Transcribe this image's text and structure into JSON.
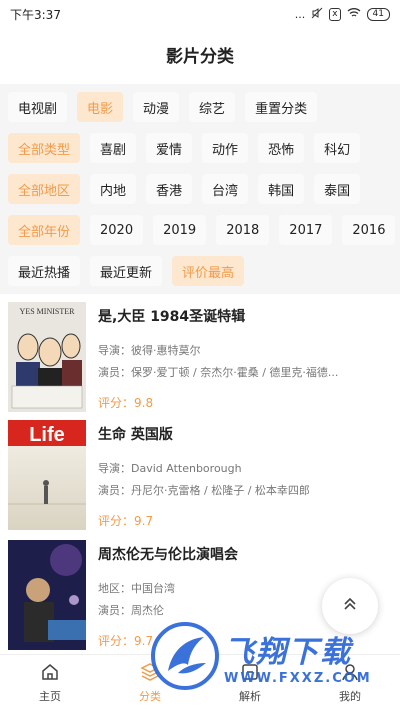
{
  "status_bar": {
    "time": "下午3:37",
    "signal": "...",
    "box_label": "x",
    "battery": "41"
  },
  "header": {
    "title": "影片分类"
  },
  "filters": {
    "row1": [
      "电视剧",
      "电影",
      "动漫",
      "综艺",
      "重置分类"
    ],
    "row1_active": 1,
    "row2": [
      "全部类型",
      "喜剧",
      "爱情",
      "动作",
      "恐怖",
      "科幻"
    ],
    "row3": [
      "全部地区",
      "内地",
      "香港",
      "台湾",
      "韩国",
      "泰国"
    ],
    "row4": [
      "全部年份",
      "2020",
      "2019",
      "2018",
      "2017",
      "2016"
    ],
    "row5": [
      "最近热播",
      "最近更新",
      "评价最高"
    ],
    "row5_active": 2
  },
  "movies": [
    {
      "title": "是,大臣 1984圣诞特辑",
      "line1": "导演：彼得·惠特莫尔",
      "line2": "演员：保罗·爱丁顿 / 奈杰尔·霍桑 / 德里克·福德...",
      "score": "评分：9.8",
      "poster_text": "YES MINISTER"
    },
    {
      "title": "生命 英国版",
      "line1": "导演：David Attenborough",
      "line2": "演员：丹尼尔·克雷格 / 松隆子 / 松本幸四郎",
      "score": "评分：9.7",
      "poster_text": "Life"
    },
    {
      "title": "周杰伦无与伦比演唱会",
      "line1": "地区：中国台湾",
      "line2": "演员：周杰伦",
      "score": "评分：9.7",
      "poster_text": ""
    }
  ],
  "bottom_nav": [
    {
      "label": "主页",
      "icon": "home-icon"
    },
    {
      "label": "分类",
      "icon": "layers-icon"
    },
    {
      "label": "解析",
      "icon": "parse-icon"
    },
    {
      "label": "我的",
      "icon": "user-icon"
    }
  ],
  "bottom_nav_active": 1,
  "watermark": {
    "cn": "飞翔下载",
    "url": "WWW.FXXZ.COM"
  },
  "colors": {
    "accent": "#f29b4a",
    "chip_active_bg": "#fde7cf",
    "watermark": "#2b66d9"
  }
}
